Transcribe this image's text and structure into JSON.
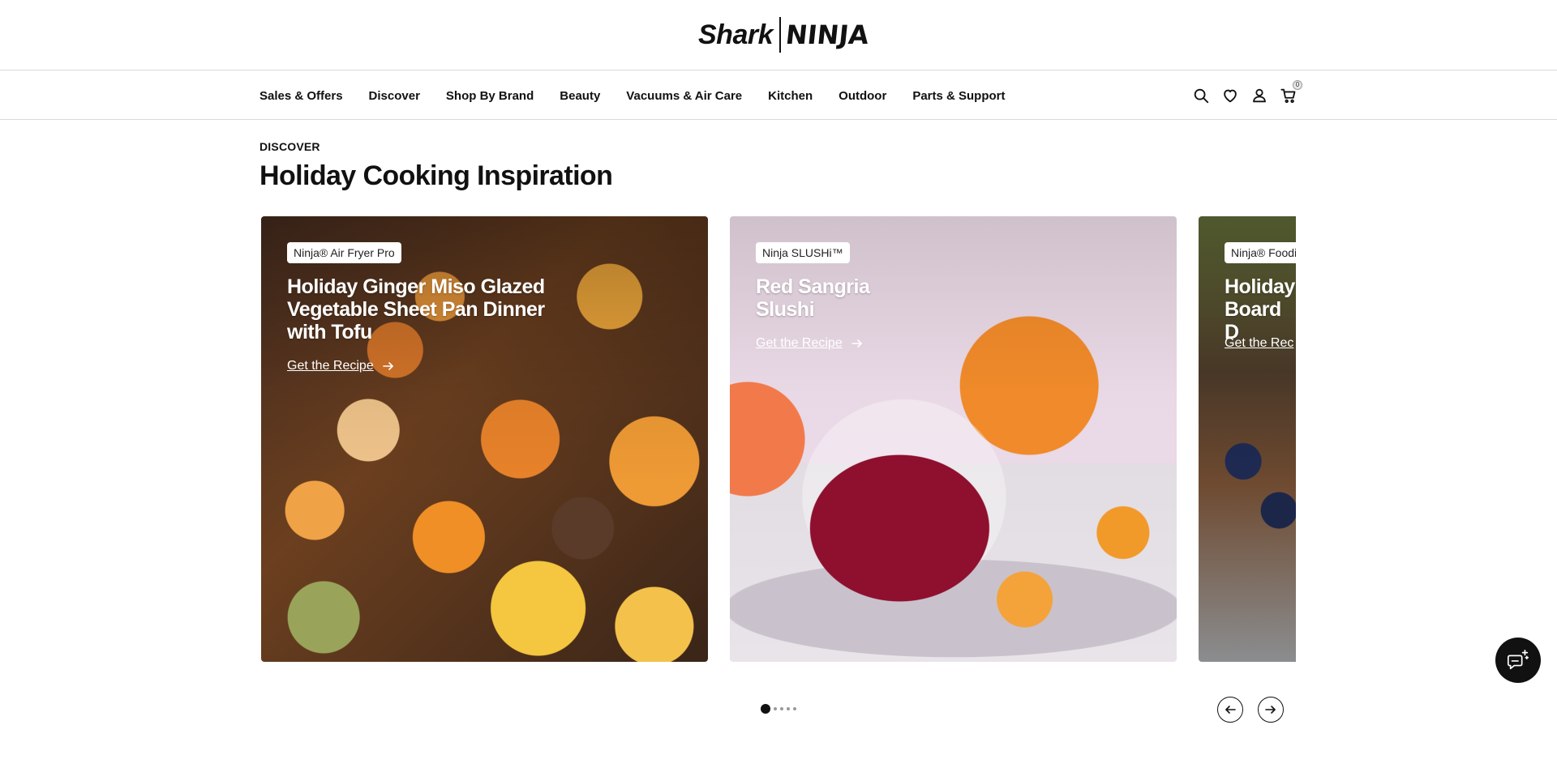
{
  "brand": {
    "logo_left": "Shark",
    "logo_right": "NINJA"
  },
  "nav": {
    "items": [
      {
        "label": "Sales & Offers"
      },
      {
        "label": "Discover"
      },
      {
        "label": "Shop By Brand"
      },
      {
        "label": "Beauty"
      },
      {
        "label": "Vacuums & Air Care"
      },
      {
        "label": "Kitchen"
      },
      {
        "label": "Outdoor"
      },
      {
        "label": "Parts & Support"
      }
    ],
    "icons": [
      "search-icon",
      "heart-icon",
      "account-icon",
      "cart-icon"
    ],
    "cart_count": "0"
  },
  "section": {
    "eyebrow": "DISCOVER",
    "title": "Holiday Cooking Inspiration"
  },
  "cards": [
    {
      "tag": "Ninja® Air Fryer Pro",
      "title": "Holiday Ginger Miso Glazed Vegetable Sheet Pan Dinner with Tofu",
      "link": "Get the Recipe"
    },
    {
      "tag": "Ninja SLUSHi™",
      "title": "Red Sangria Slushi",
      "link": "Get the Recipe"
    },
    {
      "tag": "Ninja® Foodi",
      "title": "Holiday Board D",
      "link": "Get the Rec"
    }
  ],
  "carousel": {
    "total_pages": 5,
    "current_page": 1
  },
  "colors": {
    "text": "#111111",
    "border": "#d9d9d9",
    "chat_bg": "#111111"
  }
}
